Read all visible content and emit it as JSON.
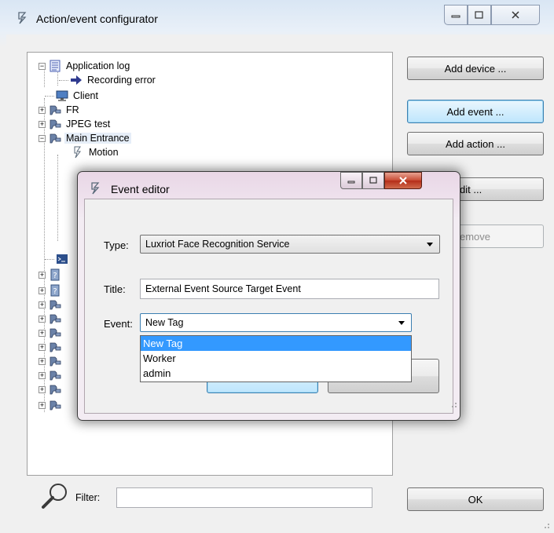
{
  "window": {
    "title": "Action/event configurator",
    "buttons": {
      "minimize": "minimize",
      "maximize": "maximize",
      "close": "close"
    }
  },
  "tree": {
    "items": [
      {
        "label": "Application log",
        "icon": "log-icon",
        "expander": "⊟"
      },
      {
        "label": "Recording error",
        "icon": "arrow-right-icon"
      },
      {
        "label": "Client",
        "icon": "monitor-icon"
      },
      {
        "label": "FR",
        "icon": "camera-icon",
        "expander": "+"
      },
      {
        "label": "JPEG test",
        "icon": "camera-icon",
        "expander": "+"
      },
      {
        "label": "Main Entrance",
        "icon": "camera-icon",
        "expander": "−"
      },
      {
        "label": "Motion",
        "icon": "event-icon"
      }
    ]
  },
  "actions": {
    "add_device": "Add device ...",
    "add_event": "Add event ...",
    "add_action": "Add action ...",
    "edit": "dit ...",
    "remove": "emove",
    "ok": "OK"
  },
  "filter": {
    "label": "Filter:",
    "value": ""
  },
  "event_editor": {
    "title": "Event editor",
    "type_label": "Type:",
    "type_value": "Luxriot Face Recognition Service",
    "title_label": "Title:",
    "title_value": "External Event Source Target Event",
    "event_label": "Event:",
    "event_value": "New Tag",
    "event_options": [
      "New Tag",
      "Worker",
      "admin"
    ]
  },
  "colors": {
    "selection": "#3399ff",
    "dialog_tint": "#e9d7e6",
    "close_red": "#c74a32"
  }
}
